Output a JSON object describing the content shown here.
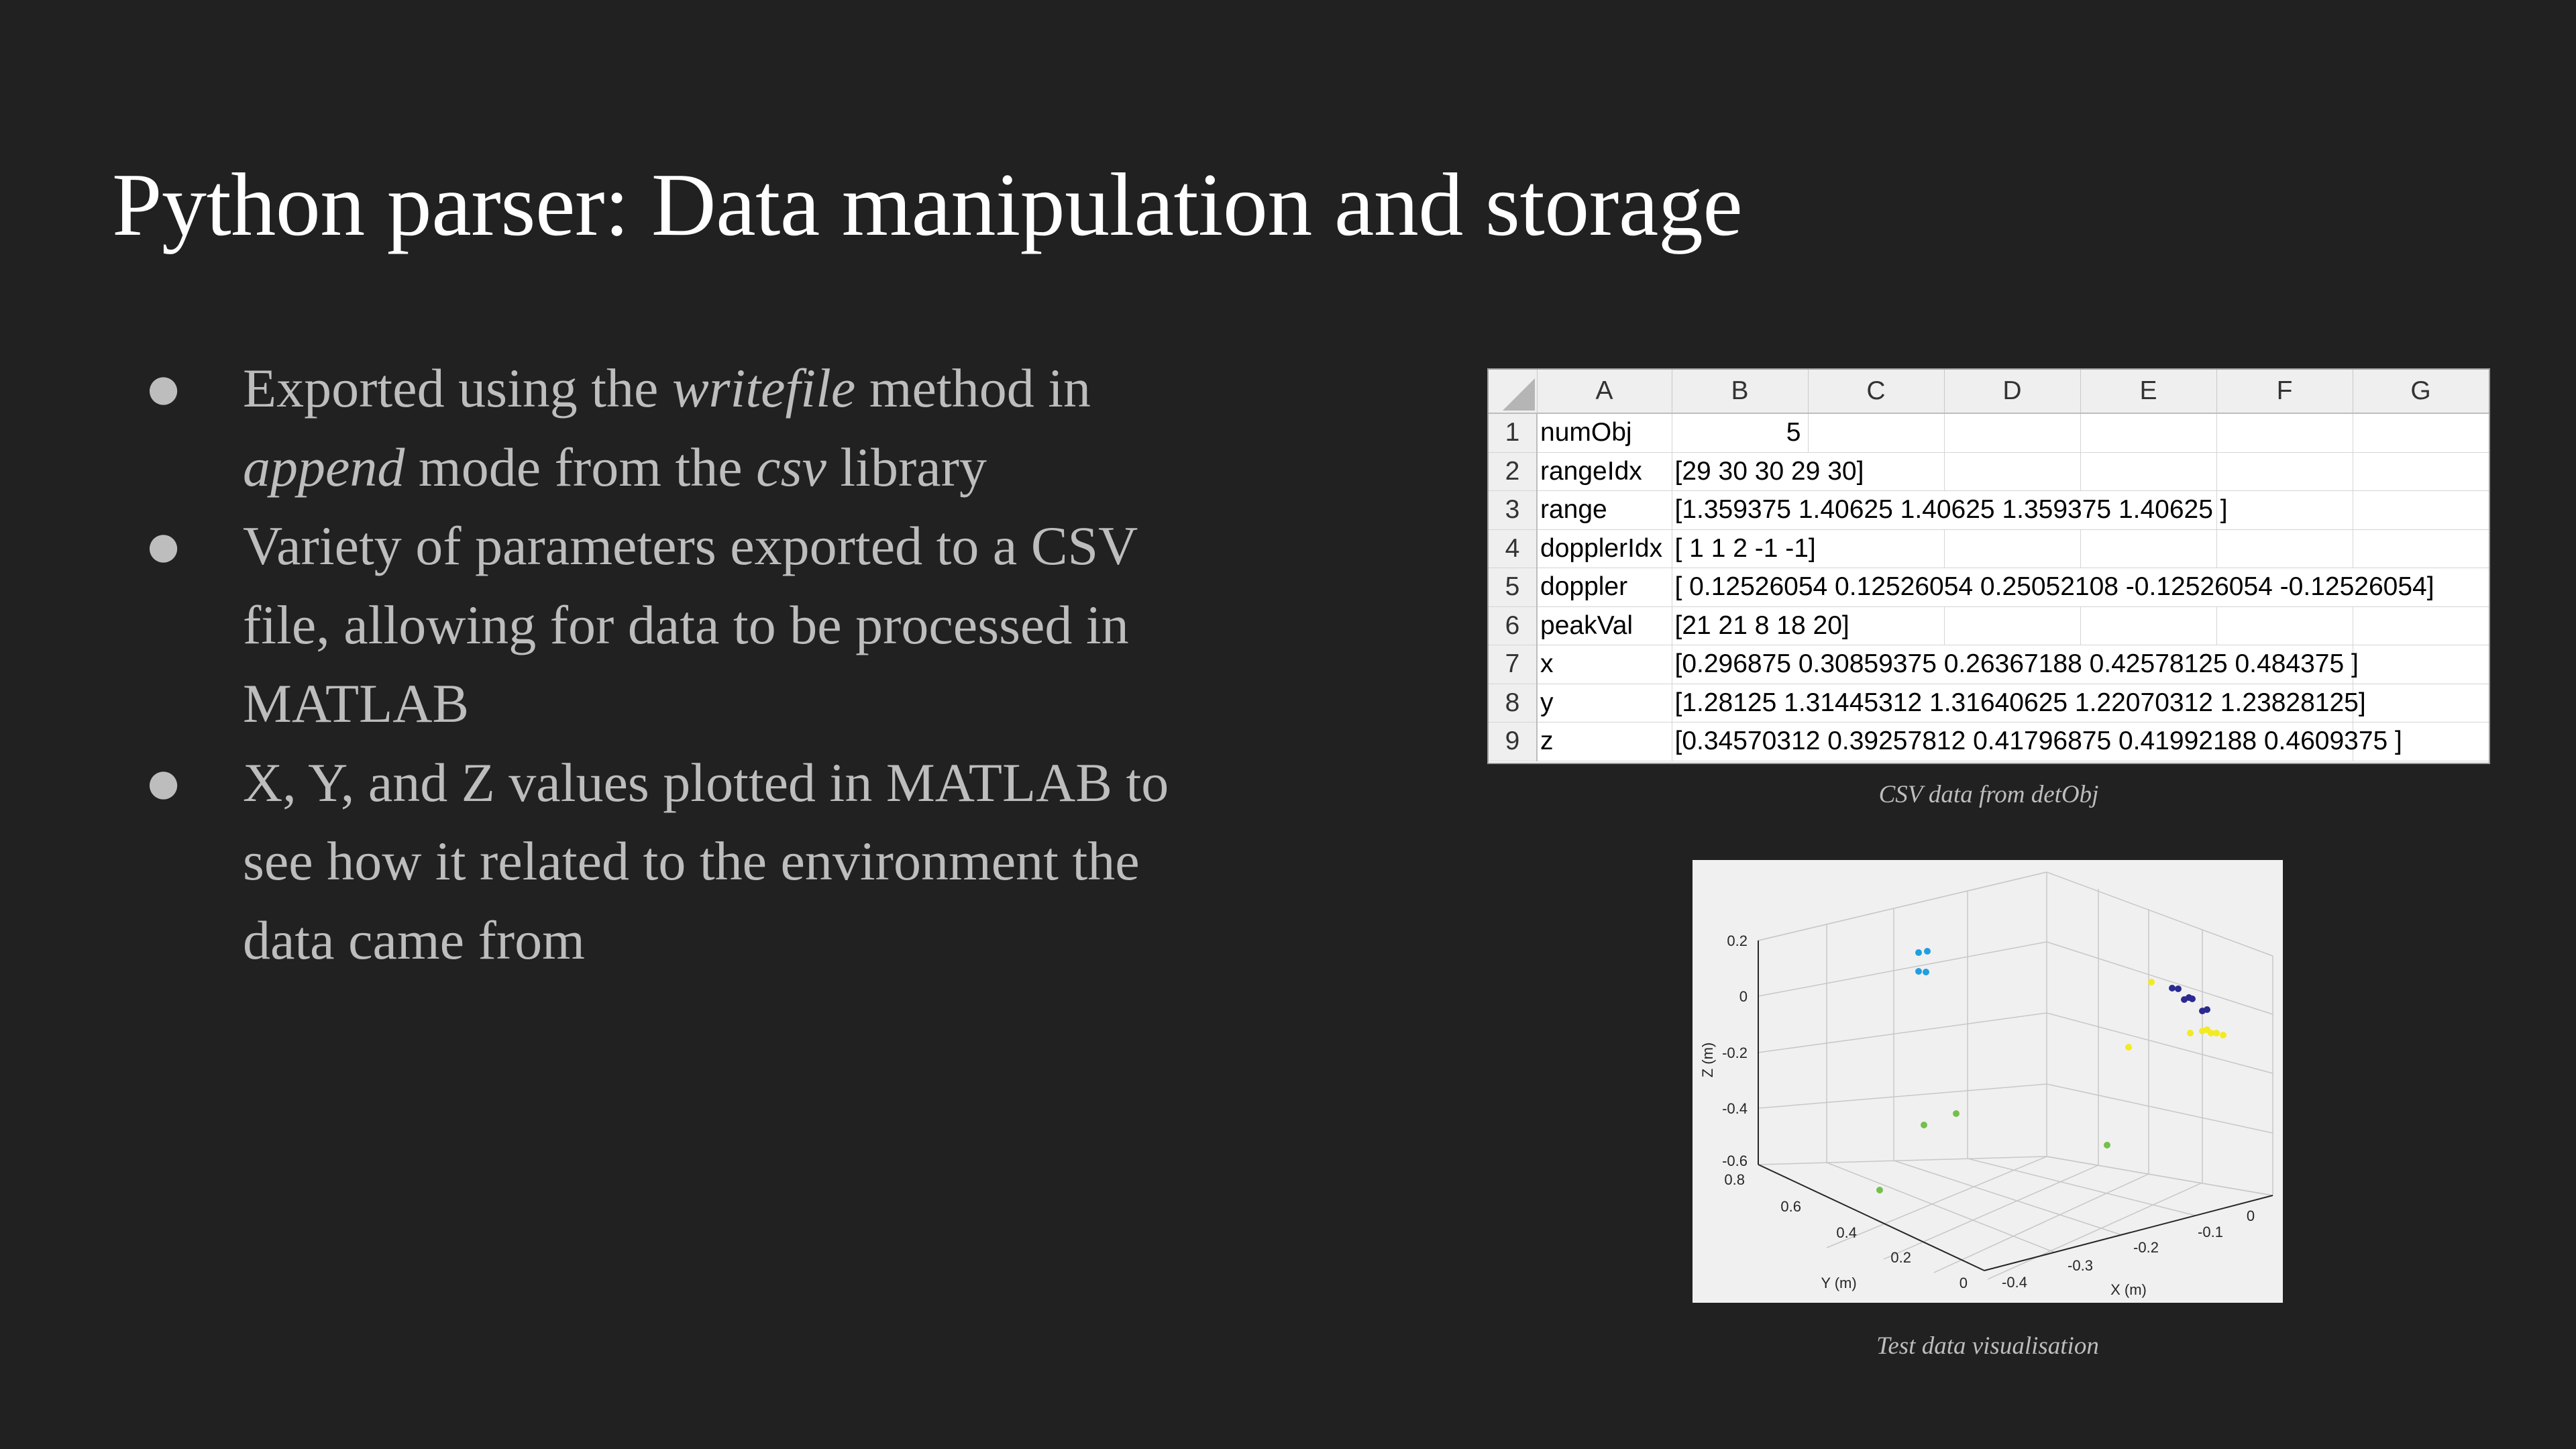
{
  "title": "Python parser: Data manipulation and storage",
  "bullets": {
    "b1": {
      "p1": "Exported using the ",
      "em1": "writefile",
      "p2": " method in",
      "em2": "append",
      "p3": " mode from the ",
      "em3": "csv",
      "p4": " library"
    },
    "b2": {
      "line1": "Variety of parameters exported to a CSV",
      "line2": "file, allowing for data to be processed in",
      "line3": "MATLAB"
    },
    "b3": {
      "line1": "X, Y, and Z values plotted in MATLAB to",
      "line2": "see how it related to the environment the",
      "line3": "data came from"
    },
    "bullet_char": "●"
  },
  "spreadsheet": {
    "columns": [
      "A",
      "B",
      "C",
      "D",
      "E",
      "F",
      "G"
    ],
    "rows": [
      {
        "num": "1",
        "a": "numObj",
        "b": "5"
      },
      {
        "num": "2",
        "a": "rangeIdx",
        "b": "[29 30 30 29 30]"
      },
      {
        "num": "3",
        "a": "range",
        "b": "[1.359375 1.40625  1.40625  1.359375 1.40625 ]"
      },
      {
        "num": "4",
        "a": "dopplerIdx",
        "b": "[ 1  1  2 -1 -1]"
      },
      {
        "num": "5",
        "a": "doppler",
        "b": "[ 0.12526054  0.12526054  0.25052108 -0.12526054 -0.12526054]"
      },
      {
        "num": "6",
        "a": "peakVal",
        "b": "[21 21  8 18 20]"
      },
      {
        "num": "7",
        "a": "x",
        "b": "[0.296875   0.30859375 0.26367188 0.42578125 0.484375  ]"
      },
      {
        "num": "8",
        "a": "y",
        "b": "[1.28125    1.31445312 1.31640625 1.22070312 1.23828125]"
      },
      {
        "num": "9",
        "a": "z",
        "b": "[0.34570312 0.39257812 0.41796875 0.41992188 0.4609375 ]"
      }
    ],
    "caption": "CSV data from detObj"
  },
  "plot": {
    "caption": "Test data visualisation",
    "zlabel": "Z (m)",
    "ylabel": "Y (m)",
    "xlabel": "X (m)",
    "z_ticks": [
      "0.2",
      "0",
      "-0.2",
      "-0.4",
      "-0.6"
    ],
    "y_ticks": [
      "0.8",
      "0.6",
      "0.4",
      "0.2",
      "0"
    ],
    "x_ticks": [
      "-0.4",
      "-0.3",
      "-0.2",
      "-0.1",
      "0"
    ],
    "colors": {
      "cyan": "#1f9ee0",
      "navy": "#2b2a8f",
      "yellow": "#f2ea23",
      "green": "#73c04b",
      "background": "#f0f0f0"
    }
  }
}
